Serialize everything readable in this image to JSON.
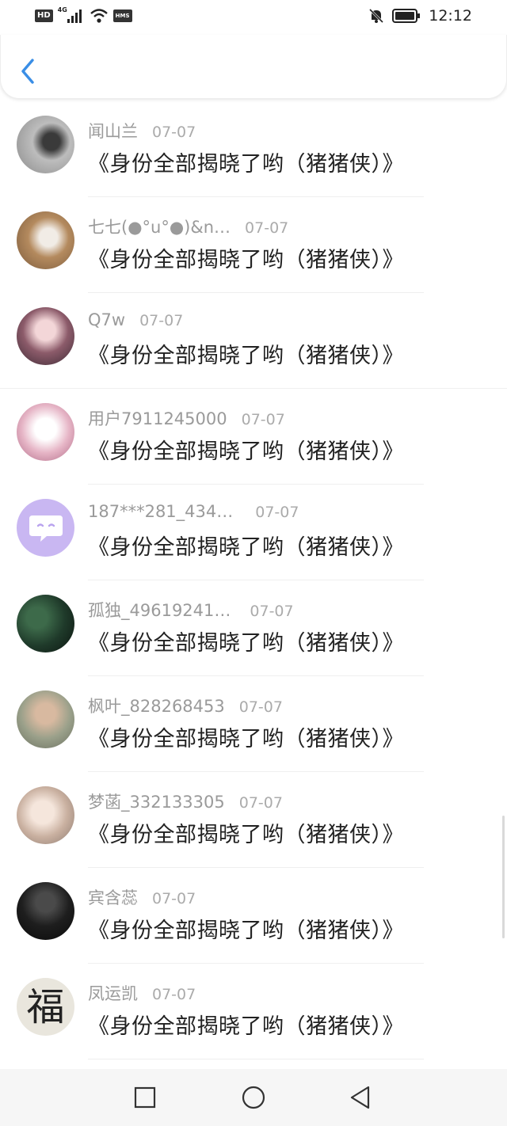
{
  "status_bar": {
    "hd": "HD",
    "signal_label": "4G",
    "hms": "HMS",
    "time": "12:12"
  },
  "header": {
    "back_icon": "chevron-left-icon"
  },
  "comments": [
    {
      "name": "闻山兰",
      "date": "07-07",
      "text": "《身份全部揭晓了哟（猪猪侠）》",
      "avatar": "photo-avatar"
    },
    {
      "name": "七七(●°u°●)&n…",
      "date": "07-07",
      "text": "《身份全部揭晓了哟（猪猪侠）》",
      "avatar": "photo-avatar"
    },
    {
      "name": "Q7w",
      "date": "07-07",
      "text": "《身份全部揭晓了哟（猪猪侠）》",
      "avatar": "photo-avatar"
    },
    {
      "name": "用户7911245000",
      "date": "07-07",
      "text": "《身份全部揭晓了哟（猪猪侠）》",
      "avatar": "photo-avatar"
    },
    {
      "name": "187***281_434…",
      "date": "07-07",
      "text": "《身份全部揭晓了哟（猪猪侠）》",
      "avatar": "default-chat-avatar"
    },
    {
      "name": "孤独_49619241…",
      "date": "07-07",
      "text": "《身份全部揭晓了哟（猪猪侠）》",
      "avatar": "photo-avatar"
    },
    {
      "name": "枫叶_828268453",
      "date": "07-07",
      "text": "《身份全部揭晓了哟（猪猪侠）》",
      "avatar": "photo-avatar"
    },
    {
      "name": "梦菡_332133305",
      "date": "07-07",
      "text": "《身份全部揭晓了哟（猪猪侠）》",
      "avatar": "photo-avatar"
    },
    {
      "name": "宾含蕊",
      "date": "07-07",
      "text": "《身份全部揭晓了哟（猪猪侠）》",
      "avatar": "photo-avatar"
    },
    {
      "name": "凤运凯",
      "date": "07-07",
      "text": "《身份全部揭晓了哟（猪猪侠）》",
      "avatar": "fu-character-avatar",
      "avatar_char": "福"
    }
  ],
  "nav_bar": {
    "recent_icon": "square-icon",
    "home_icon": "circle-icon",
    "back_icon": "triangle-back-icon"
  },
  "colors": {
    "accent": "#3a8ee6",
    "name_gray": "#9a9a9a",
    "date_gray": "#ababab",
    "text": "#222222",
    "default_avatar": "#c9b7f2"
  }
}
